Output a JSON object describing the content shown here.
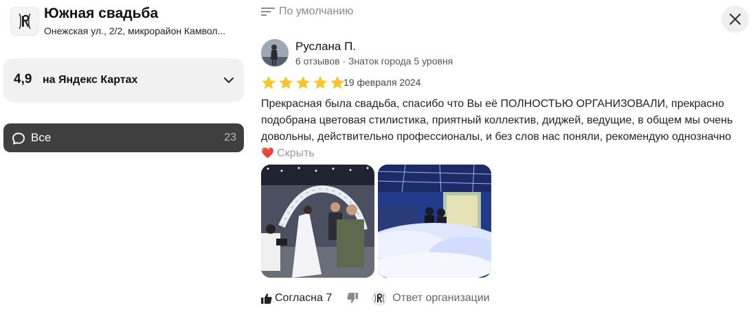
{
  "org": {
    "name": "Южная свадьба",
    "address": "Онежская ул., 2/2, микрорайон Камвол...",
    "logo_icon": "wedding-monogram-icon"
  },
  "rating": {
    "value": "4,9",
    "source": "на Яндекс Картах",
    "chevron_icon": "chevron-down-icon"
  },
  "filter": {
    "label": "Все",
    "count": "23",
    "icon": "chat-bubble-icon"
  },
  "sort": {
    "label": "По умолчанию",
    "icon": "sort-lines-icon"
  },
  "close_icon": "close-icon",
  "review": {
    "author": "Руслана П.",
    "meta": "6 отзывов · Знаток города 5 уровня",
    "stars": 5,
    "date": "19 февраля 2024",
    "text": "Прекрасная была свадьба, спасибо что Вы её ПОЛНОСТЬЮ ОРГАНИЗОВАЛИ, прекрасно подобрана цветовая стилистика, приятный коллектив, диджей, ведущие, в общем мы очень довольны, действительно профессионалы, и без слов нас поняли, рекомендую однозначно",
    "emoji": "❤️",
    "hide_label": "Скрыть",
    "photos": [
      "wedding-ceremony-photo",
      "dance-floor-fog-photo"
    ]
  },
  "actions": {
    "agree_label": "Согласна 7",
    "answer_label": "Ответ организации"
  },
  "colors": {
    "accent_dark": "#3f3f3f",
    "star": "#fcc42a",
    "heart": "#e8456b",
    "muted": "#8a8a8a"
  }
}
